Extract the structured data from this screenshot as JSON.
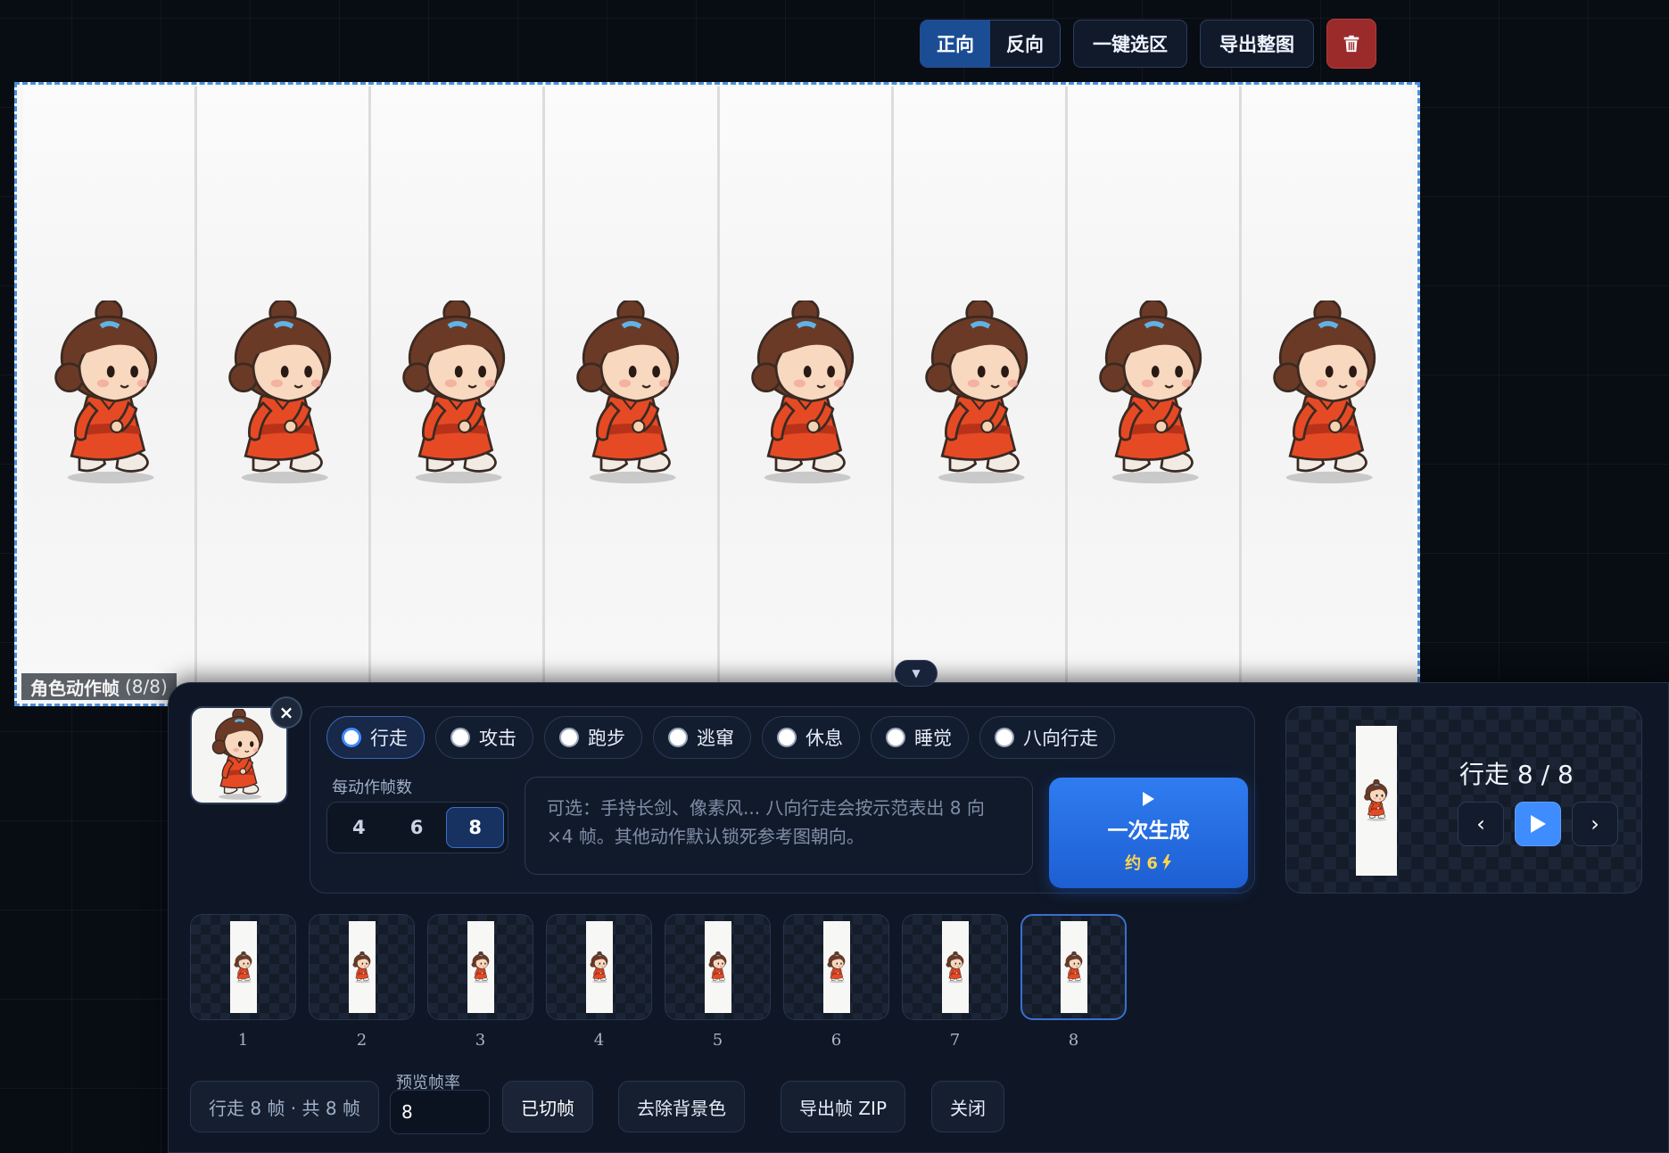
{
  "toolbar": {
    "forward": "正向",
    "reverse": "反向",
    "select_all": "一键选区",
    "export_image": "导出整图",
    "delete_icon": "trash-icon"
  },
  "sheet": {
    "label": "角色动作帧",
    "count": "(8/8)",
    "frame_count": 8
  },
  "panel": {
    "actions": [
      {
        "label": "行走",
        "selected": true
      },
      {
        "label": "攻击",
        "selected": false
      },
      {
        "label": "跑步",
        "selected": false
      },
      {
        "label": "逃窜",
        "selected": false
      },
      {
        "label": "休息",
        "selected": false
      },
      {
        "label": "睡觉",
        "selected": false
      },
      {
        "label": "八向行走",
        "selected": false
      }
    ],
    "frames_per_action_label": "每动作帧数",
    "frame_count_options": [
      "4",
      "6",
      "8"
    ],
    "frame_count_selected": "8",
    "prompt_placeholder": "可选：手持长剑、像素风... 八向行走会按示范表出 8 向×4 帧。其他动作默认锁死参考图朝向。",
    "generate": {
      "label": "一次生成",
      "cost": "约 6"
    },
    "preview": {
      "title": "行走 8 / 8",
      "prev": "‹",
      "next": "›"
    },
    "frame_numbers": [
      "1",
      "2",
      "3",
      "4",
      "5",
      "6",
      "7",
      "8"
    ],
    "active_frame": 8,
    "summary": "行走 8 帧 · 共 8 帧",
    "fps_label": "预览帧率",
    "fps_value": "8",
    "buttons": {
      "cut": "已切帧",
      "remove_bg": "去除背景色",
      "export_zip": "导出帧 ZIP",
      "close": "关闭"
    }
  },
  "colors": {
    "accent": "#3f8cff",
    "danger": "#9b2b2b",
    "costume": "#e64a25",
    "hair": "#6b3a26"
  }
}
